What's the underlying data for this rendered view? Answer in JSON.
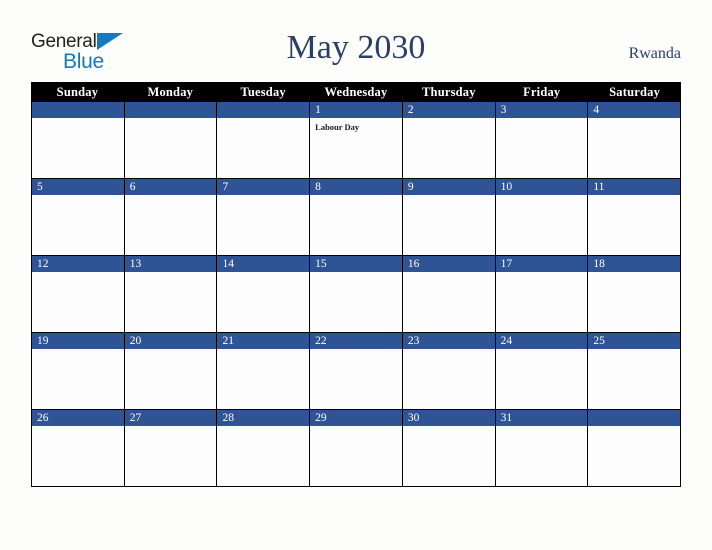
{
  "brand": {
    "line1": "General",
    "line2": "Blue",
    "accent_color": "#1479bf",
    "text_color": "#231f20"
  },
  "header": {
    "title": "May 2030",
    "country": "Rwanda",
    "title_color": "#2b3f66"
  },
  "calendar": {
    "weekdays": [
      "Sunday",
      "Monday",
      "Tuesday",
      "Wednesday",
      "Thursday",
      "Friday",
      "Saturday"
    ],
    "header_bg": "#000000",
    "day_band_bg": "#2e5496",
    "cell_bg": "#fdfdfd",
    "weeks": [
      [
        {
          "day": "",
          "events": []
        },
        {
          "day": "",
          "events": []
        },
        {
          "day": "",
          "events": []
        },
        {
          "day": "1",
          "events": [
            "Labour Day"
          ]
        },
        {
          "day": "2",
          "events": []
        },
        {
          "day": "3",
          "events": []
        },
        {
          "day": "4",
          "events": []
        }
      ],
      [
        {
          "day": "5",
          "events": []
        },
        {
          "day": "6",
          "events": []
        },
        {
          "day": "7",
          "events": []
        },
        {
          "day": "8",
          "events": []
        },
        {
          "day": "9",
          "events": []
        },
        {
          "day": "10",
          "events": []
        },
        {
          "day": "11",
          "events": []
        }
      ],
      [
        {
          "day": "12",
          "events": []
        },
        {
          "day": "13",
          "events": []
        },
        {
          "day": "14",
          "events": []
        },
        {
          "day": "15",
          "events": []
        },
        {
          "day": "16",
          "events": []
        },
        {
          "day": "17",
          "events": []
        },
        {
          "day": "18",
          "events": []
        }
      ],
      [
        {
          "day": "19",
          "events": []
        },
        {
          "day": "20",
          "events": []
        },
        {
          "day": "21",
          "events": []
        },
        {
          "day": "22",
          "events": []
        },
        {
          "day": "23",
          "events": []
        },
        {
          "day": "24",
          "events": []
        },
        {
          "day": "25",
          "events": []
        }
      ],
      [
        {
          "day": "26",
          "events": []
        },
        {
          "day": "27",
          "events": []
        },
        {
          "day": "28",
          "events": []
        },
        {
          "day": "29",
          "events": []
        },
        {
          "day": "30",
          "events": []
        },
        {
          "day": "31",
          "events": []
        },
        {
          "day": "",
          "events": []
        }
      ]
    ]
  }
}
